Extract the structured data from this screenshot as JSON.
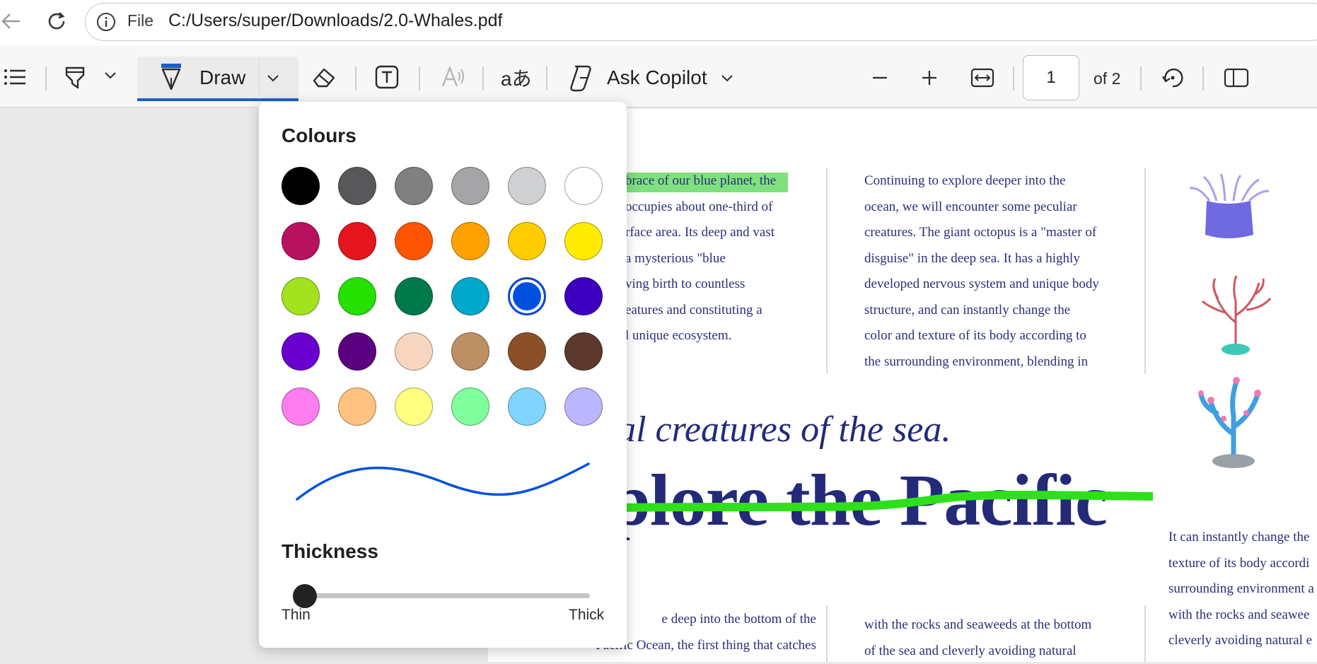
{
  "address_bar": {
    "file_label": "File",
    "url": "C:/Users/super/Downloads/2.0-Whales.pdf"
  },
  "toolbar": {
    "draw_label": "Draw",
    "copilot_label": "Ask Copilot",
    "page_current": "1",
    "page_of": "of 2",
    "accent_color": "#1a5fc9"
  },
  "draw_panel": {
    "colours_title": "Colours",
    "colours": [
      [
        "#000000",
        "#58585a",
        "#808080",
        "#a5a5a7",
        "#cfd0d2",
        "#ffffff"
      ],
      [
        "#b8115d",
        "#e6141c",
        "#ff5500",
        "#ffa100",
        "#ffcc00",
        "#ffec00"
      ],
      [
        "#a2e21f",
        "#26e000",
        "#007a4a",
        "#00a8cc",
        "#0050e0",
        "#3e00bf"
      ],
      [
        "#6a00cf",
        "#5b0080",
        "#f7d5bf",
        "#bd8f64",
        "#8c5028",
        "#5c392c"
      ],
      [
        "#ff7df0",
        "#ffc280",
        "#ffff80",
        "#80ff9d",
        "#80d5ff",
        "#bcb5ff"
      ]
    ],
    "selected_colour": "#0050e0",
    "thickness_title": "Thickness",
    "thin_label": "Thin",
    "thick_label": "Thick",
    "thickness_level": 0.03
  },
  "document": {
    "col1_lines": [
      "brace of our blue planet, the",
      " occupies about one-third of",
      "rface area. Its deep and vast",
      " a mysterious \"blue",
      "ving birth to countless",
      "eatures and constituting a",
      "l unique ecosystem."
    ],
    "col2_lines": [
      "Continuing to explore deeper into the",
      "ocean, we will encounter some peculiar",
      "creatures. The giant octopus is a \"master of",
      "disguise\" in the deep sea. It has a highly",
      "developed nervous system and unique body",
      "structure, and can instantly change the",
      "color and texture of its body according to",
      "the surrounding environment, blending in"
    ],
    "subtitle": "cal creatures of the sea.",
    "title": "plore the Pacific",
    "col3_lower_lines": [
      "It can instantly change the",
      "texture of its body accordi",
      "surrounding environment a",
      "with the rocks and seawee",
      "cleverly avoiding natural e"
    ],
    "col1_bottom_lines": [
      "e deep into the bottom of the",
      "Pacific Ocean, the first thing that catches"
    ],
    "col2_bottom_lines": [
      "with the rocks and seaweeds at the bottom",
      "of the sea and cleverly avoiding natural"
    ],
    "highlight_color": "#7ee07e",
    "strike_color": "#2ee01a"
  }
}
